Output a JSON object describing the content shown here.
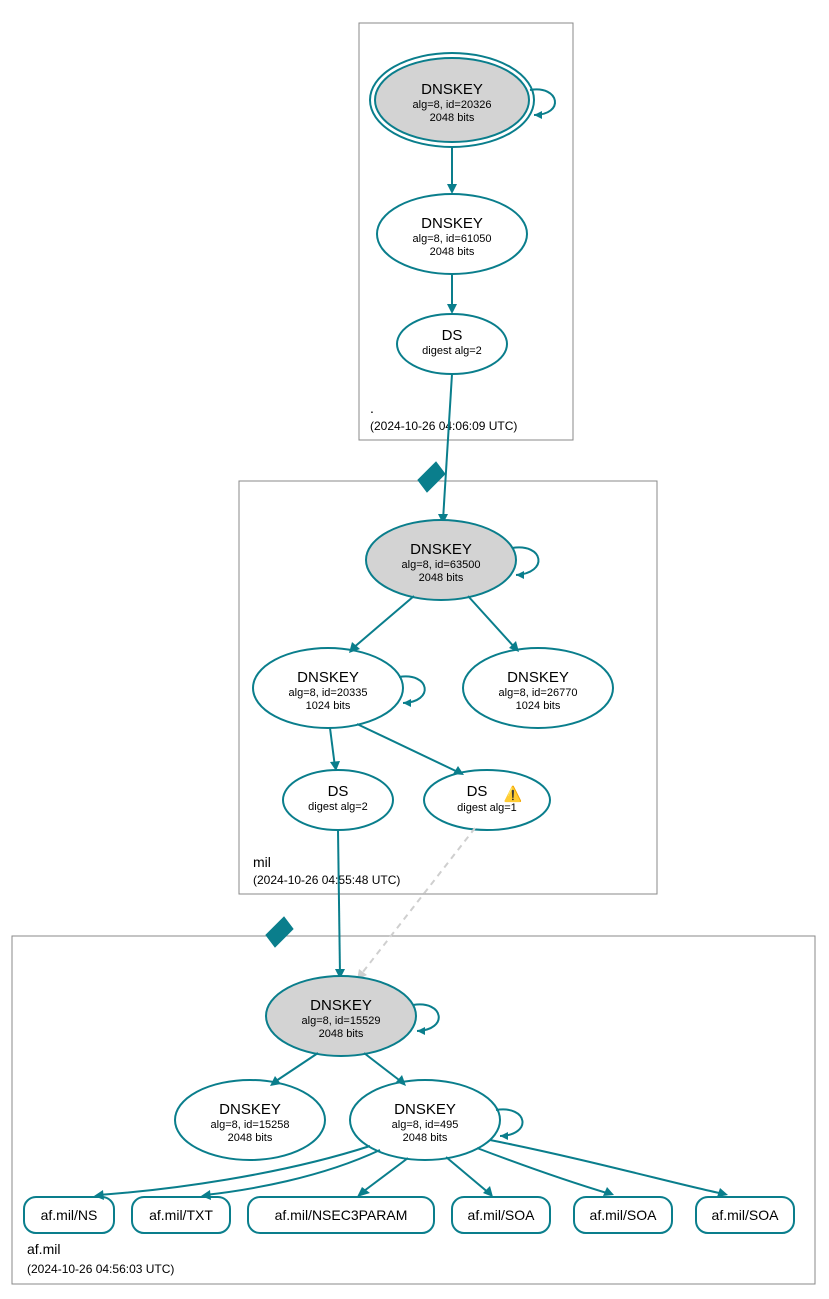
{
  "colors": {
    "stroke": "#0a7e8c",
    "ksk_fill": "#d3d3d3"
  },
  "zones": {
    "root": {
      "name": ".",
      "timestamp": "(2024-10-26 04:06:09 UTC)"
    },
    "mil": {
      "name": "mil",
      "timestamp": "(2024-10-26 04:55:48 UTC)"
    },
    "afmil": {
      "name": "af.mil",
      "timestamp": "(2024-10-26 04:56:03 UTC)"
    }
  },
  "nodes": {
    "root_ksk": {
      "title": "DNSKEY",
      "line1": "alg=8, id=20326",
      "line2": "2048 bits"
    },
    "root_zsk": {
      "title": "DNSKEY",
      "line1": "alg=8, id=61050",
      "line2": "2048 bits"
    },
    "root_ds": {
      "title": "DS",
      "line1": "digest alg=2"
    },
    "mil_ksk": {
      "title": "DNSKEY",
      "line1": "alg=8, id=63500",
      "line2": "2048 bits"
    },
    "mil_zsk1": {
      "title": "DNSKEY",
      "line1": "alg=8, id=20335",
      "line2": "1024 bits"
    },
    "mil_zsk2": {
      "title": "DNSKEY",
      "line1": "alg=8, id=26770",
      "line2": "1024 bits"
    },
    "mil_ds1": {
      "title": "DS",
      "line1": "digest alg=2"
    },
    "mil_ds2": {
      "title": "DS",
      "line1": "digest alg=1",
      "warn": "⚠️"
    },
    "af_ksk": {
      "title": "DNSKEY",
      "line1": "alg=8, id=15529",
      "line2": "2048 bits"
    },
    "af_zsk1": {
      "title": "DNSKEY",
      "line1": "alg=8, id=15258",
      "line2": "2048 bits"
    },
    "af_zsk2": {
      "title": "DNSKEY",
      "line1": "alg=8, id=495",
      "line2": "2048 bits"
    }
  },
  "rrsets": {
    "r1": "af.mil/NS",
    "r2": "af.mil/TXT",
    "r3": "af.mil/NSEC3PARAM",
    "r4": "af.mil/SOA",
    "r5": "af.mil/SOA",
    "r6": "af.mil/SOA"
  }
}
